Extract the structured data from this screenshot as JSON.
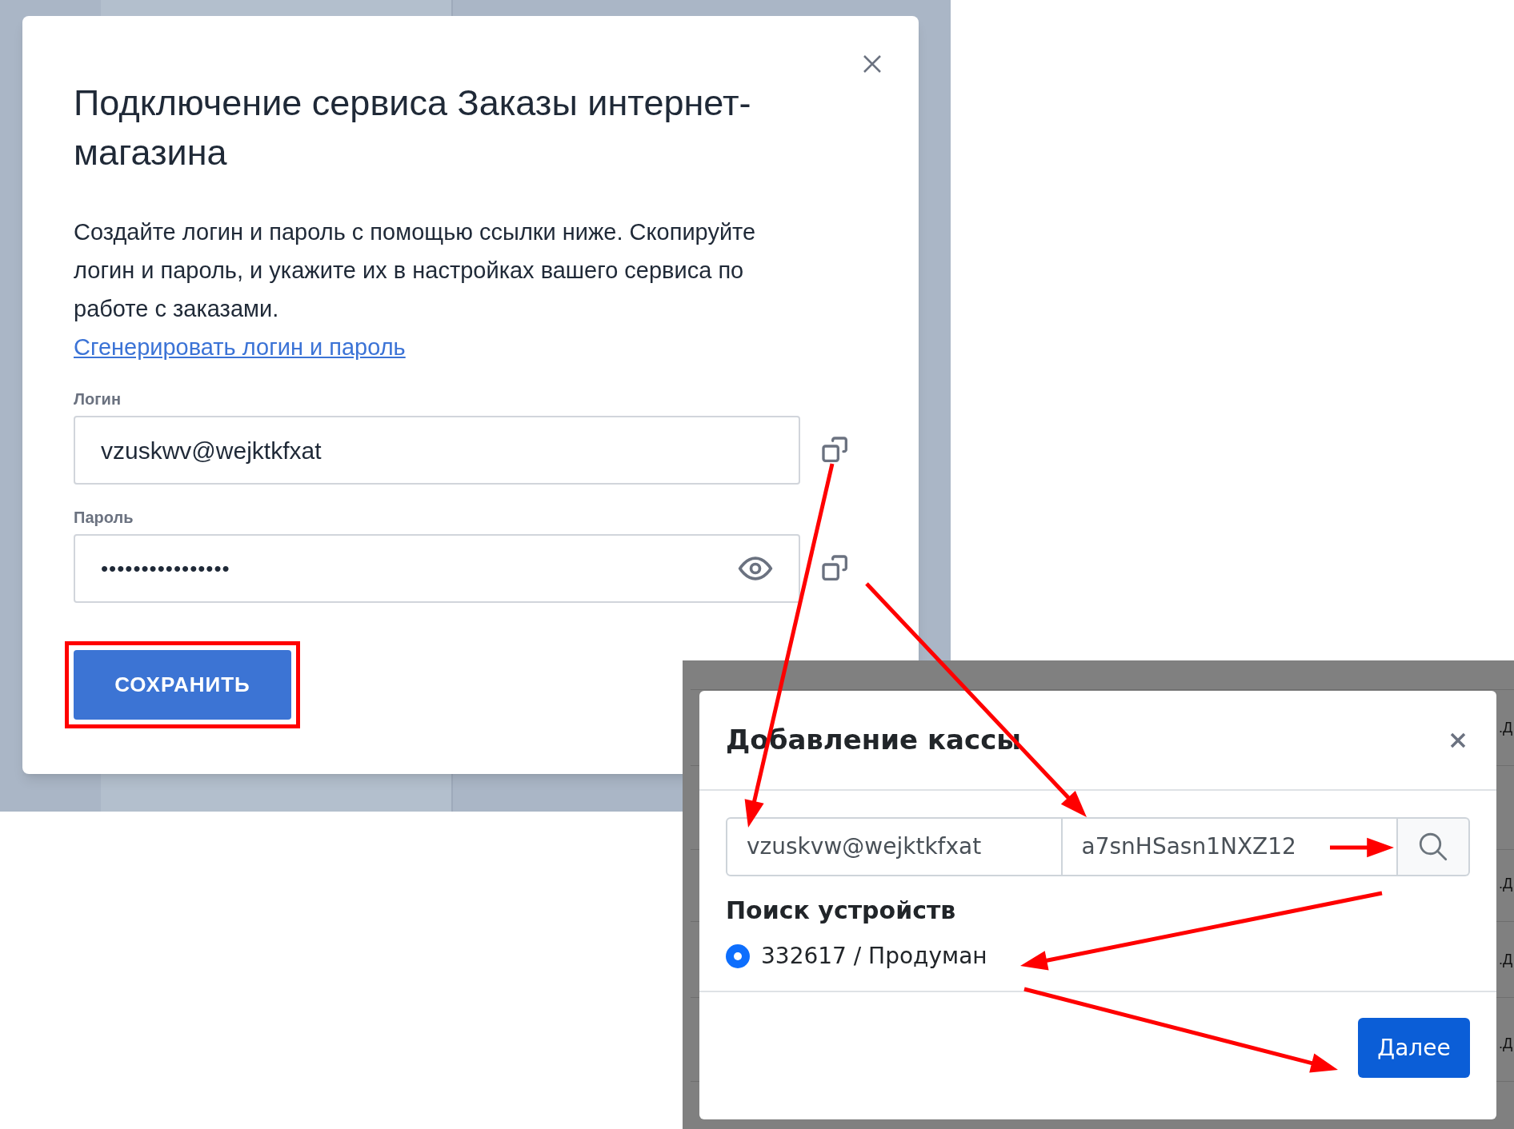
{
  "connect_dialog": {
    "title": "Подключение сервиса Заказы интернет-магазина",
    "description": "Создайте логин и пароль с помощью ссылки ниже. Скопируйте логин и пароль, и укажите их в настройках вашего сервиса по работе с заказами.",
    "link": "Сгенерировать логин и пароль",
    "fields": [
      {
        "kind": "text",
        "label": "Логин",
        "value": "vzuskwv@wejktkfxat"
      },
      {
        "kind": "password",
        "label": "Пароль",
        "value": "••••••••••••••••"
      }
    ],
    "save_button": "СОХРАНИТЬ"
  },
  "cash_background": {
    "fragments": [
      ".Д",
      ".Д",
      ".Д",
      ".Д"
    ]
  },
  "cash_dialog": {
    "title": "Добавление кассы",
    "login": "vzuskvw@wejktkfxat",
    "password": "a7snHSasn1NXZ12",
    "section_title": "Поиск устройств",
    "devices": [
      {
        "label": "332617 / Продуман",
        "selected": true
      }
    ],
    "next_button": "Далее"
  }
}
